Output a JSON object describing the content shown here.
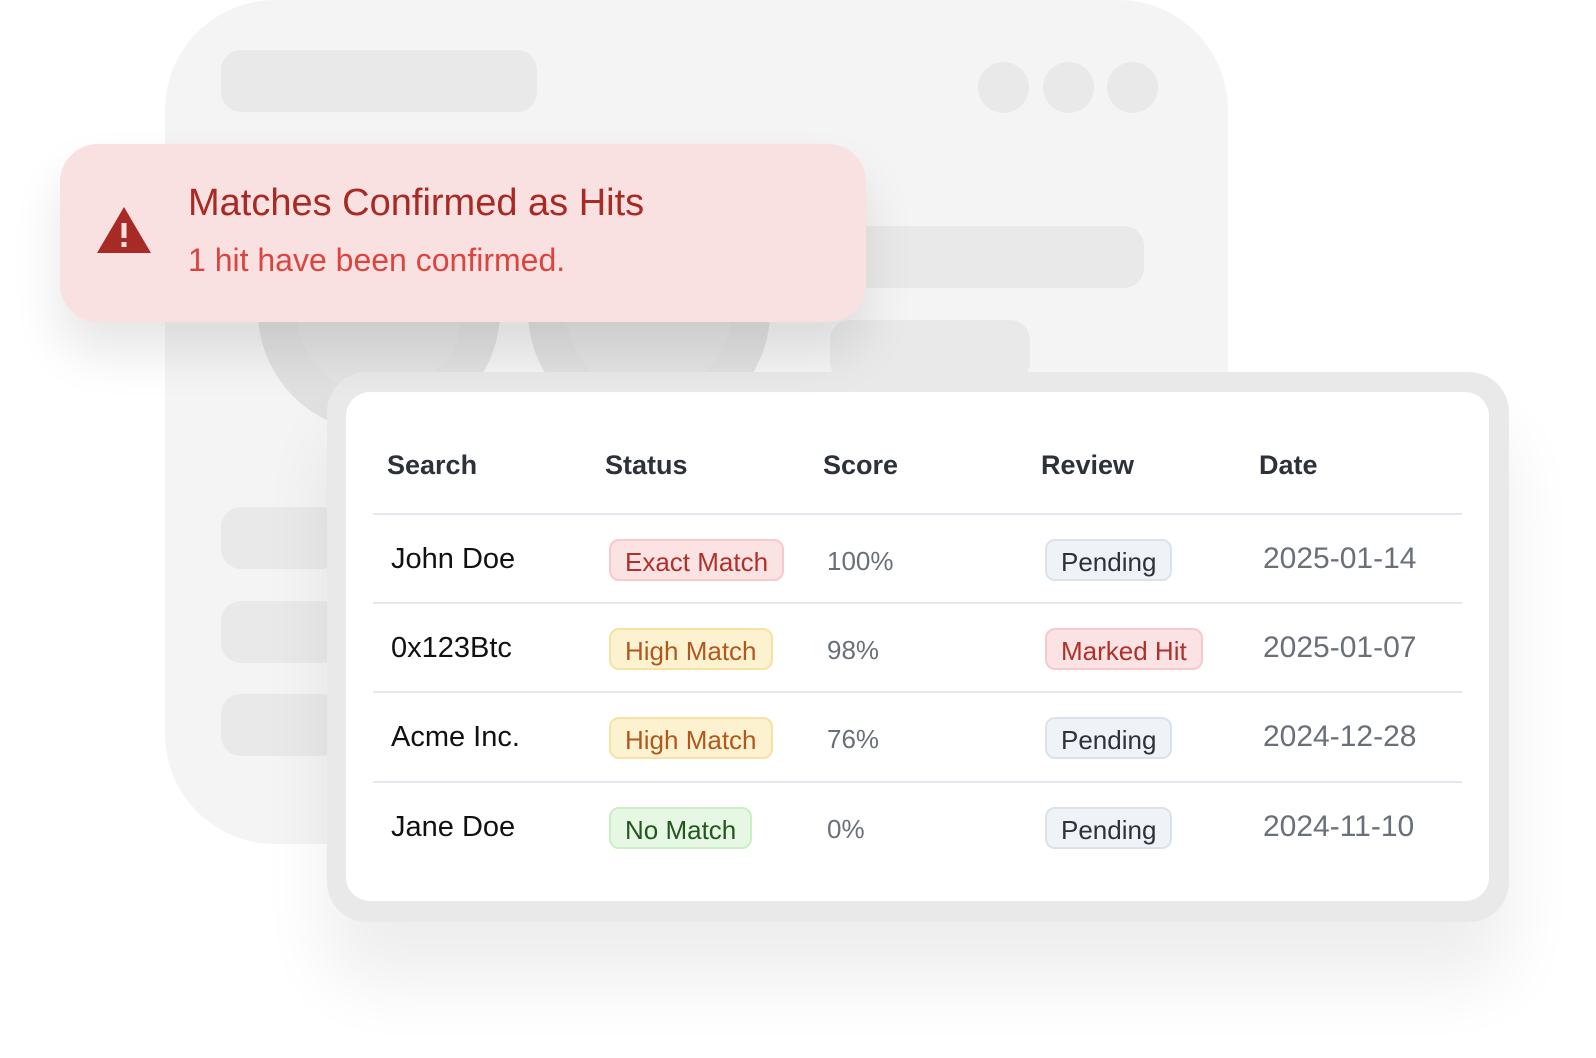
{
  "alert": {
    "icon": "warning-triangle-icon",
    "title": "Matches Confirmed as Hits",
    "message": "1 hit have been confirmed.",
    "color": "#a82a24",
    "background": "#f9e1e2"
  },
  "table": {
    "headers": [
      "Search",
      "Status",
      "Score",
      "Review",
      "Date"
    ],
    "rows": [
      {
        "search": "John Doe",
        "status": "Exact Match",
        "status_type": "exact",
        "score": "100%",
        "review": "Pending",
        "review_type": "pending",
        "date": "2025-01-14"
      },
      {
        "search": "0x123Btc",
        "status": "High Match",
        "status_type": "high",
        "score": "98%",
        "review": "Marked Hit",
        "review_type": "hit",
        "date": "2025-01-07"
      },
      {
        "search": "Acme Inc.",
        "status": "High Match",
        "status_type": "high",
        "score": "76%",
        "review": "Pending",
        "review_type": "pending",
        "date": "2024-12-28"
      },
      {
        "search": "Jane Doe",
        "status": "No Match",
        "status_type": "none",
        "score": "0%",
        "review": "Pending",
        "review_type": "pending",
        "date": "2024-11-10"
      }
    ]
  },
  "colors": {
    "exact": "#b0302b",
    "high": "#b1581f",
    "none": "#24561f",
    "pending": "#2d3139",
    "hit": "#b0302b"
  }
}
